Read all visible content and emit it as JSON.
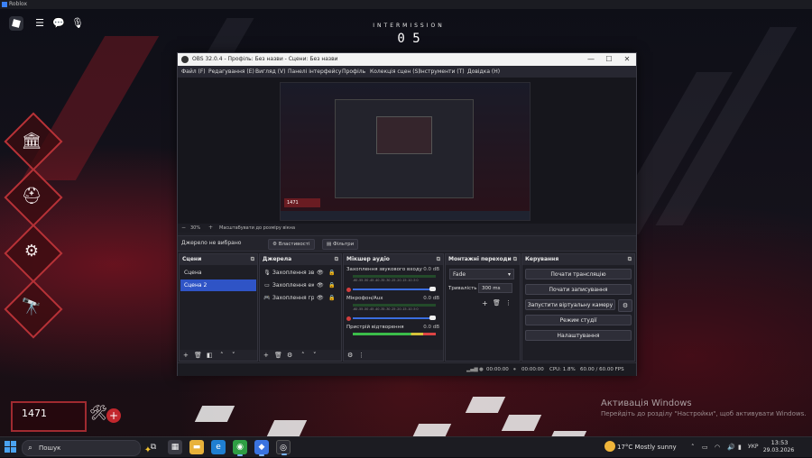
{
  "game": {
    "window_title": "Roblox",
    "intermission_label": "INTERMISSION",
    "intermission_count": "0 5",
    "score": "1471"
  },
  "windows_activation": {
    "title": "Активація Windows",
    "subtitle": "Перейдіть до розділу \"Настройки\", щоб активувати Windows."
  },
  "obs": {
    "title": "OBS 32.0.4 - Профіль: Без назви - Сцени: Без назви",
    "menu": [
      "Файл (F)",
      "Редагування (E)",
      "Вигляд (V)",
      "Панелі інтерфейсу",
      "Профіль",
      "Колекція сцен (S)",
      "Інструменти (T)",
      "Довідка (H)"
    ],
    "zoom": "30%",
    "zoom_mode": "Масштабувати до розміру вікна",
    "no_source": "Джерело не вибрано",
    "properties_btn": "Властивості",
    "filters_btn": "Фільтри",
    "scenes": {
      "title": "Сцени",
      "items": [
        "Сцена",
        "Сцена 2"
      ],
      "selected": "Сцена 2"
    },
    "sources": {
      "title": "Джерела",
      "items": [
        "Захоплення звукового",
        "Захоплення екрана",
        "Захоплення гри"
      ]
    },
    "mixer": {
      "title": "Мікшер аудіо",
      "scale": "-60 -55 -50 -45 -40 -35 -30 -25 -20 -15 -10 -5 0",
      "channels": [
        {
          "name": "Захоплення звукового входу",
          "db": "0.0 dB"
        },
        {
          "name": "Мікрофон/Aux",
          "db": "0.0 dB"
        },
        {
          "name": "Пристрій відтворення",
          "db": "0.0 dB"
        }
      ]
    },
    "transitions": {
      "title": "Монтажні переходи",
      "selected": "Fade",
      "duration_label": "Тривалість",
      "duration_value": "300 ms"
    },
    "controls": {
      "title": "Керування",
      "start_stream": "Почати трансляцію",
      "start_record": "Почати записування",
      "start_vcam": "Запустити віртуальну камеру",
      "studio_mode": "Режим студії",
      "settings": "Налаштування"
    },
    "status": {
      "stream_time": "00:00:00",
      "record_time": "00:00:00",
      "cpu": "CPU: 1.8%",
      "fps": "60.00 / 60.00 FPS"
    }
  },
  "taskbar": {
    "search_placeholder": "Пошук",
    "weather": "17°C  Mostly sunny",
    "language": "УКР",
    "time": "13:53",
    "date": "29.03.2026"
  }
}
